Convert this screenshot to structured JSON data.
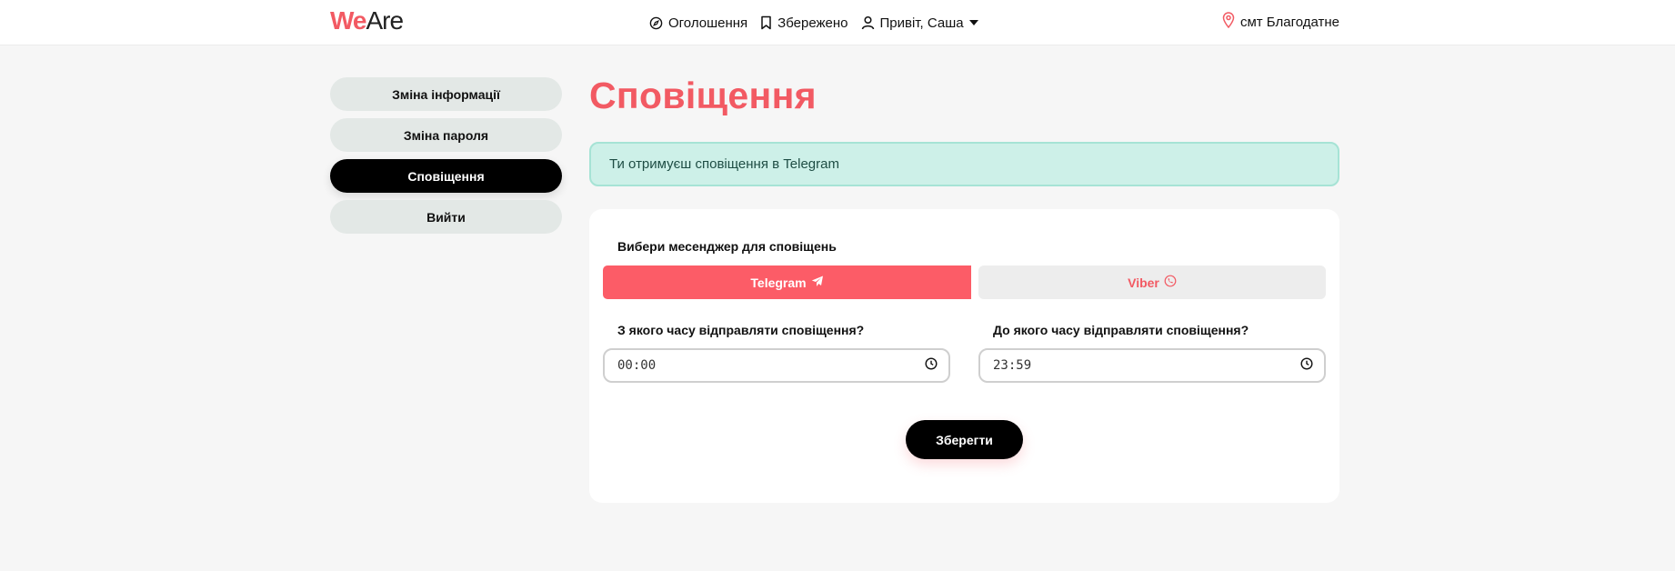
{
  "header": {
    "logo": {
      "we": "We",
      "are": "Are"
    },
    "nav": [
      {
        "label": "Оголошення",
        "icon": "compass-icon"
      },
      {
        "label": "Збережено",
        "icon": "bookmark-icon"
      },
      {
        "label": "Привіт, Саша",
        "icon": "user-icon",
        "dropdown": true
      }
    ],
    "location": {
      "label": "смт Благодатне",
      "icon": "map-pin-icon"
    }
  },
  "sidebar": {
    "items": [
      {
        "label": "Зміна інформації",
        "active": false
      },
      {
        "label": "Зміна пароля",
        "active": false
      },
      {
        "label": "Сповіщення",
        "active": true
      },
      {
        "label": "Вийти",
        "active": false
      }
    ]
  },
  "main": {
    "title": "Сповіщення",
    "alert": "Ти отримуєш сповіщення в Telegram",
    "messenger_label": "Вибери месенджер для сповіщень",
    "messengers": {
      "telegram": "Telegram",
      "viber": "Viber",
      "selected": "Telegram"
    },
    "from_label": "З якого часу відправляти сповіщення?",
    "to_label": "До якого часу відправляти сповіщення?",
    "from_value": "00:00",
    "to_value": "23:59",
    "save_label": "Зберегти"
  },
  "colors": {
    "accent": "#f25a63",
    "alert_bg": "#cdf0e8",
    "active_nav": "#000000",
    "sidebar_bg": "#e3e8e6"
  }
}
